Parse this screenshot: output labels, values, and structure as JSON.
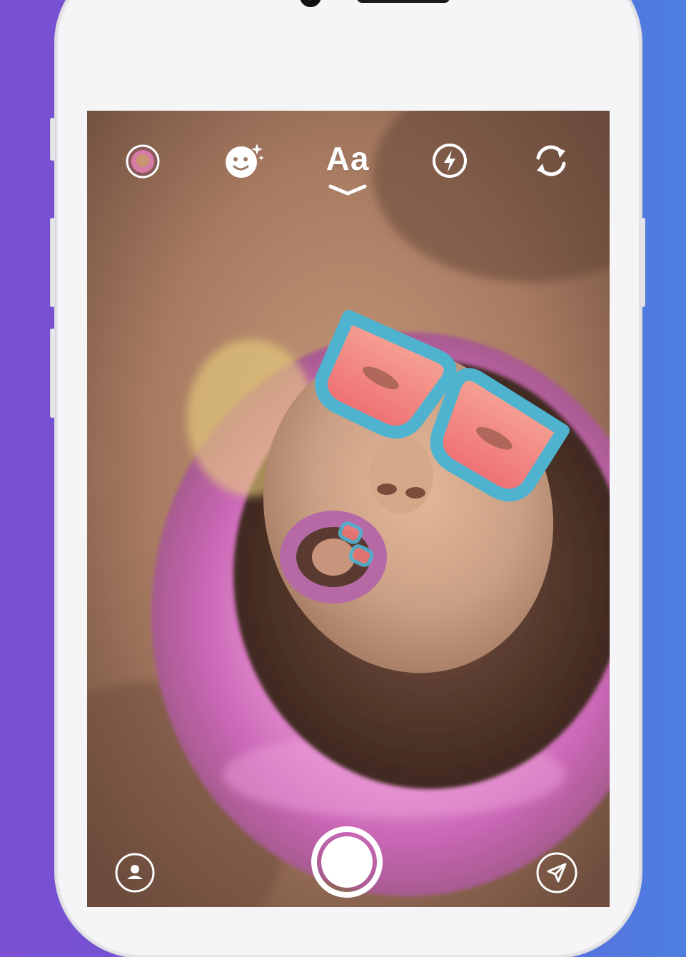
{
  "app": {
    "screen": "story-camera"
  },
  "toolbar": {
    "text_tool_label": "Aa",
    "icons": [
      "profile-thumbnail-icon",
      "face-filter-icon",
      "text-tool-icon",
      "flash-icon",
      "switch-camera-icon"
    ]
  },
  "bottom_bar": {
    "icons": [
      "profile-icon",
      "shutter-button",
      "send-icon"
    ]
  },
  "colors": {
    "background_left": "#7a4fd1",
    "background_right": "#4c7fe0",
    "phone_body": "#f5f5f7",
    "lips": "#d46fb6",
    "glasses_frame": "#4fb3d0",
    "lenses": "#f07a78",
    "ui_white": "#ffffff"
  }
}
